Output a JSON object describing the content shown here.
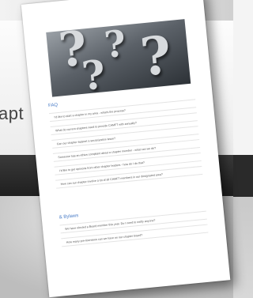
{
  "background": {
    "partial_word": "apt"
  },
  "document": {
    "section_faq": {
      "title": "FAQ",
      "items": [
        "I'd like to start a chapter in my area - what's the process?",
        "What do current chapters need to provide CAMFT with annually?",
        "Can our chapter support a social justice issue?",
        "Someone has an ethics complaint about a chapter member - what can we do?",
        "I'd like to get opinions from other chapter leaders - how do I do that?",
        "How can our chapter involve a lot of all CAMFT members in our designated area?"
      ]
    },
    "section_bylaws": {
      "title": "& Bylaws",
      "items": [
        "We have elected a Board member this year. Do I need to notify anyone?",
        "How many pre-licensees can we have on our chapter board?"
      ]
    }
  },
  "colors": {
    "heading": "#4a7cc7",
    "dark_band": "#2a2a2a"
  }
}
